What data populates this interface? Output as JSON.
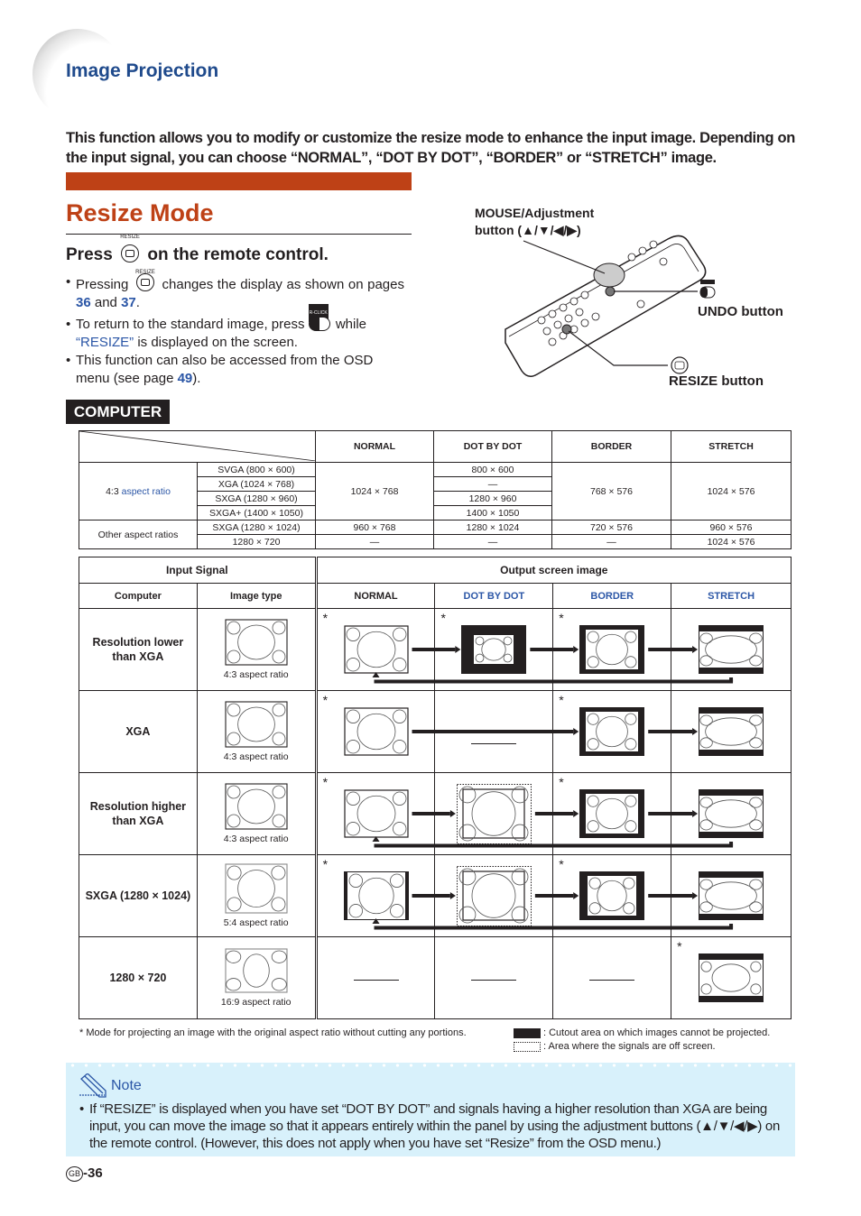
{
  "header": {
    "section_title": "Image Projection",
    "intro": "This function allows you to modify or customize the resize mode to enhance the input image. Depending on the input signal, you can choose “NORMAL”, “DOT BY DOT”, “BORDER” or “STRETCH” image."
  },
  "colors": {
    "accent_red": "#be4116",
    "link_blue": "#2b56a6",
    "section_blue": "#1f4a8c",
    "note_bg": "#d8f1fb"
  },
  "resize_mode": {
    "title": "Resize Mode",
    "press_prefix": "Press",
    "press_suffix": "on the remote control.",
    "resize_icon_caption": "RESIZE",
    "undo_icon_caption_top": "R-CLICK",
    "undo_icon_caption": "UNDO",
    "bullet1_a": "Pressing",
    "bullet1_b": "changes the display as shown on pages",
    "bullet1_p1": "36",
    "bullet1_and": "and",
    "bullet1_p2": "37",
    "bullet2_a": "To return to the standard image, press",
    "bullet2_b": "while",
    "bullet2_link": "“RESIZE”",
    "bullet2_c": "is displayed on the screen.",
    "bullet3_a": "This function can also be accessed from the OSD menu (see page",
    "bullet3_page": "49",
    "bullet3_b": ")."
  },
  "remote": {
    "mouse_label_1": "MOUSE/Adjustment",
    "mouse_label_2": "button (▲/▼/◀/▶)",
    "undo_label": "UNDO button",
    "resize_label": "RESIZE button"
  },
  "computer_badge": "COMPUTER",
  "spec_table": {
    "headers": [
      "NORMAL",
      "DOT BY DOT",
      "BORDER",
      "STRETCH"
    ],
    "group1_label_a": "4:3",
    "group1_label_b": "aspect ratio",
    "group2_label": "Other aspect ratios",
    "rows": [
      {
        "signal": "SVGA (800 × 600)",
        "normal": "1024 × 768",
        "dot": "800 × 600",
        "border": "768 × 576",
        "stretch": "1024 × 576"
      },
      {
        "signal": "XGA (1024 × 768)",
        "dot": "—"
      },
      {
        "signal": "SXGA (1280 × 960)",
        "dot": "1280 × 960"
      },
      {
        "signal": "SXGA+ (1400 × 1050)",
        "dot": "1400 × 1050"
      },
      {
        "signal": "SXGA (1280 × 1024)",
        "normal": "960 × 768",
        "dot": "1280 × 1024",
        "border": "720 × 576",
        "stretch": "960 × 576"
      },
      {
        "signal": "1280 × 720",
        "normal": "—",
        "dot": "—",
        "border": "—",
        "stretch": "1024 × 576"
      }
    ]
  },
  "output_table": {
    "input_signal": "Input Signal",
    "output_screen": "Output screen image",
    "col_computer": "Computer",
    "col_image_type": "Image type",
    "col_normal": "NORMAL",
    "col_dot": "DOT BY DOT",
    "col_border": "BORDER",
    "col_stretch": "STRETCH",
    "star": "*",
    "rows": [
      {
        "computer": "Resolution lower than XGA",
        "caption": "4:3 aspect ratio"
      },
      {
        "computer": "XGA",
        "caption": "4:3 aspect ratio"
      },
      {
        "computer": "Resolution higher than XGA",
        "caption": "4:3 aspect ratio"
      },
      {
        "computer": "SXGA (1280 × 1024)",
        "caption": "5:4 aspect ratio"
      },
      {
        "computer": "1280 × 720",
        "caption": "16:9 aspect ratio"
      }
    ]
  },
  "footnotes": {
    "star_note": "*  Mode for projecting an image with the original aspect ratio without cutting any portions.",
    "black_legend": ": Cutout area on which images cannot be projected.",
    "dotted_legend": ": Area where the signals are off screen."
  },
  "note": {
    "title": "Note",
    "text": "If “RESIZE” is displayed when you have set “DOT BY DOT” and signals having a higher resolution than XGA are being input, you can move the image so that it appears entirely within the panel by using the adjustment buttons (▲/▼/◀/▶) on the remote control. (However, this does not apply when you have set “Resize” from the OSD menu.)"
  },
  "footer": {
    "region_badge": "GB",
    "page_number": "-36"
  }
}
